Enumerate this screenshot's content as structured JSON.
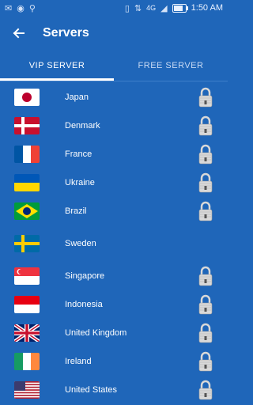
{
  "status": {
    "network": "4G",
    "time": "1:50 AM"
  },
  "header": {
    "title": "Servers"
  },
  "tabs": [
    {
      "label": "VIP SERVER",
      "active": true
    },
    {
      "label": "FREE SERVER",
      "active": false
    }
  ],
  "servers": [
    {
      "name": "Japan",
      "locked": true
    },
    {
      "name": "Denmark",
      "locked": true
    },
    {
      "name": "France",
      "locked": true
    },
    {
      "name": "Ukraine",
      "locked": true
    },
    {
      "name": "Brazil",
      "locked": true
    },
    {
      "name": "Sweden",
      "locked": false
    },
    {
      "name": "Singapore",
      "locked": true
    },
    {
      "name": "Indonesia",
      "locked": true
    },
    {
      "name": "United Kingdom",
      "locked": true
    },
    {
      "name": "Ireland",
      "locked": true
    },
    {
      "name": "United States",
      "locked": true
    }
  ]
}
